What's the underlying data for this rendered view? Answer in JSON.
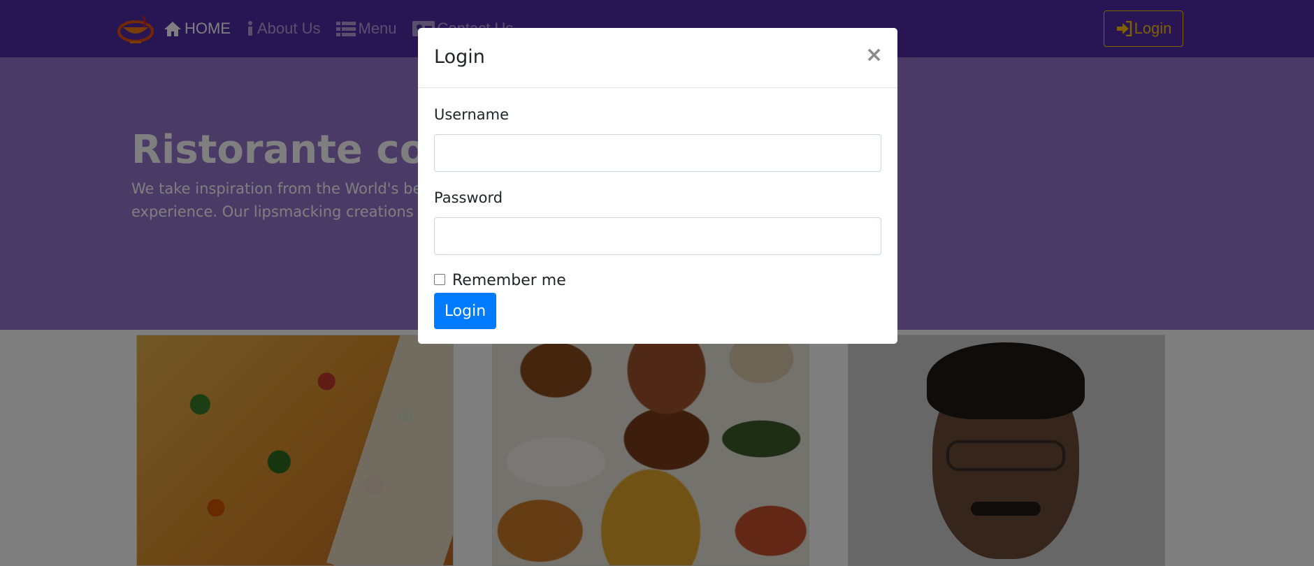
{
  "navbar": {
    "logo_icon": "restaurant-logo",
    "items": [
      {
        "label": "HOME",
        "icon": "home-icon",
        "active": true
      },
      {
        "label": "About Us",
        "icon": "info-icon",
        "active": false
      },
      {
        "label": "Menu",
        "icon": "list-icon",
        "active": false
      },
      {
        "label": "Contact Us",
        "icon": "address-card-icon",
        "active": false
      }
    ],
    "login_label": "Login",
    "login_icon": "sign-in-icon"
  },
  "jumbotron": {
    "title": "Ristorante con Fusion",
    "text": "We take inspiration from the World's best cuisines, and create a unique fusion experience. Our lipsmacking creations will tickle your culinary senses!"
  },
  "cards": [
    {
      "image": "pizza-photo"
    },
    {
      "image": "buffet-photo"
    },
    {
      "image": "chef-portrait-photo"
    }
  ],
  "modal": {
    "title": "Login",
    "close_label": "×",
    "username_label": "Username",
    "username_value": "",
    "password_label": "Password",
    "password_value": "",
    "remember_label": "Remember me",
    "remember_checked": false,
    "submit_label": "Login"
  },
  "colors": {
    "navbar": "#512da8",
    "jumbotron": "#9575cd",
    "accent": "#ffc107",
    "primary_button": "#007bff"
  }
}
